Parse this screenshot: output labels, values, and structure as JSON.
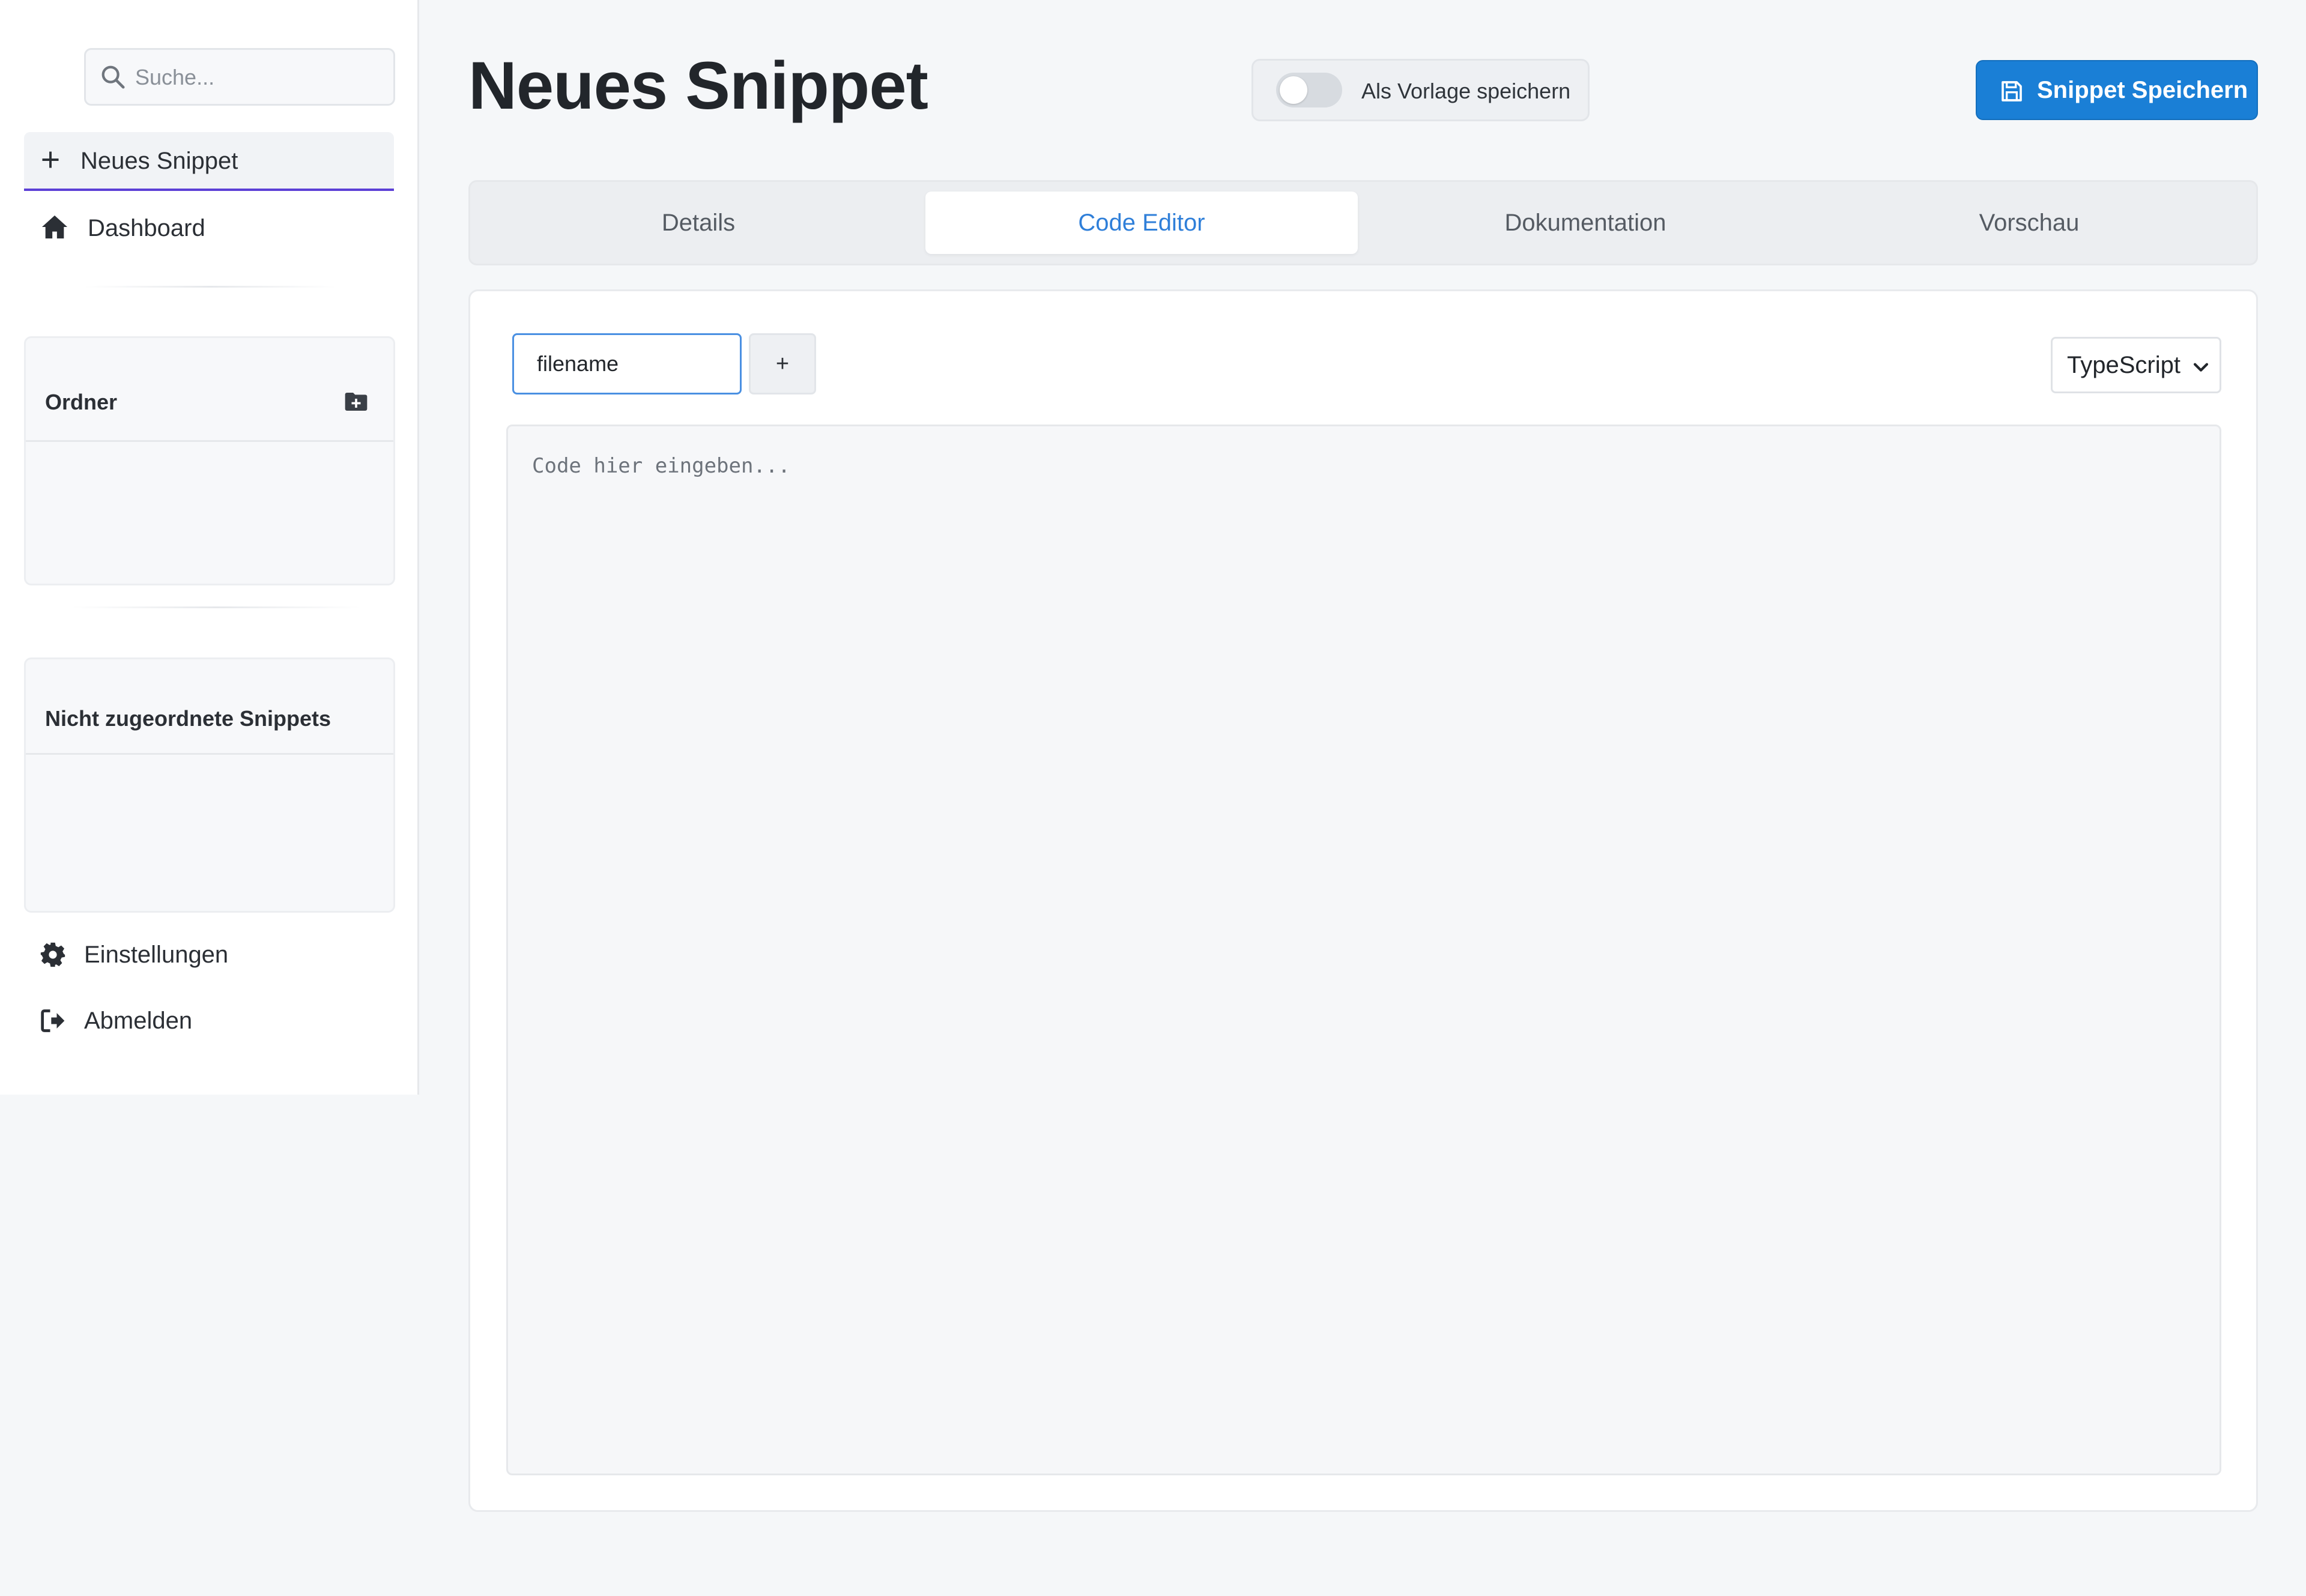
{
  "sidebar": {
    "search_placeholder": "Suche...",
    "new_snippet_label": "Neues Snippet",
    "dashboard_label": "Dashboard",
    "folders_title": "Ordner",
    "unassigned_title": "Nicht zugeordnete Snippets",
    "settings_label": "Einstellungen",
    "logout_label": "Abmelden"
  },
  "header": {
    "title": "Neues Snippet",
    "template_toggle_label": "Als Vorlage speichern",
    "template_toggle_on": false,
    "save_label": "Snippet Speichern"
  },
  "tabs": [
    {
      "label": "Details",
      "active": false
    },
    {
      "label": "Code Editor",
      "active": true
    },
    {
      "label": "Dokumentation",
      "active": false
    },
    {
      "label": "Vorschau",
      "active": false
    }
  ],
  "editor": {
    "filename_value": "filename",
    "add_file_label": "+",
    "language": "TypeScript",
    "code_placeholder": "Code hier eingeben..."
  },
  "colors": {
    "accent": "#1a7fd6",
    "active_tab_text": "#2f7fd9",
    "nav_underline": "#5b3fd6"
  }
}
